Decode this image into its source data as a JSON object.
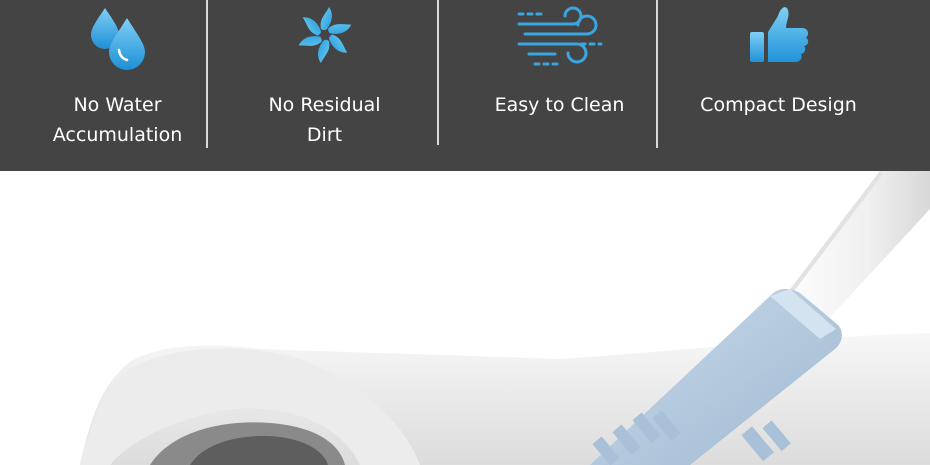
{
  "features": [
    {
      "label_line1": "No Water",
      "label_line2": "Accumulation",
      "icon": "water-drops-icon"
    },
    {
      "label_line1": "No Residual",
      "label_line2": "Dirt",
      "icon": "swirl-fan-icon"
    },
    {
      "label_line1": "Easy to Clean",
      "label_line2": "",
      "icon": "wind-icon"
    },
    {
      "label_line1": "Compact Design",
      "label_line2": "",
      "icon": "thumbs-up-icon"
    }
  ],
  "colors": {
    "banner_bg": "#444444",
    "icon_blue": "#3aa6e0",
    "brush_blue": "#b9cde0",
    "text": "#ffffff"
  }
}
